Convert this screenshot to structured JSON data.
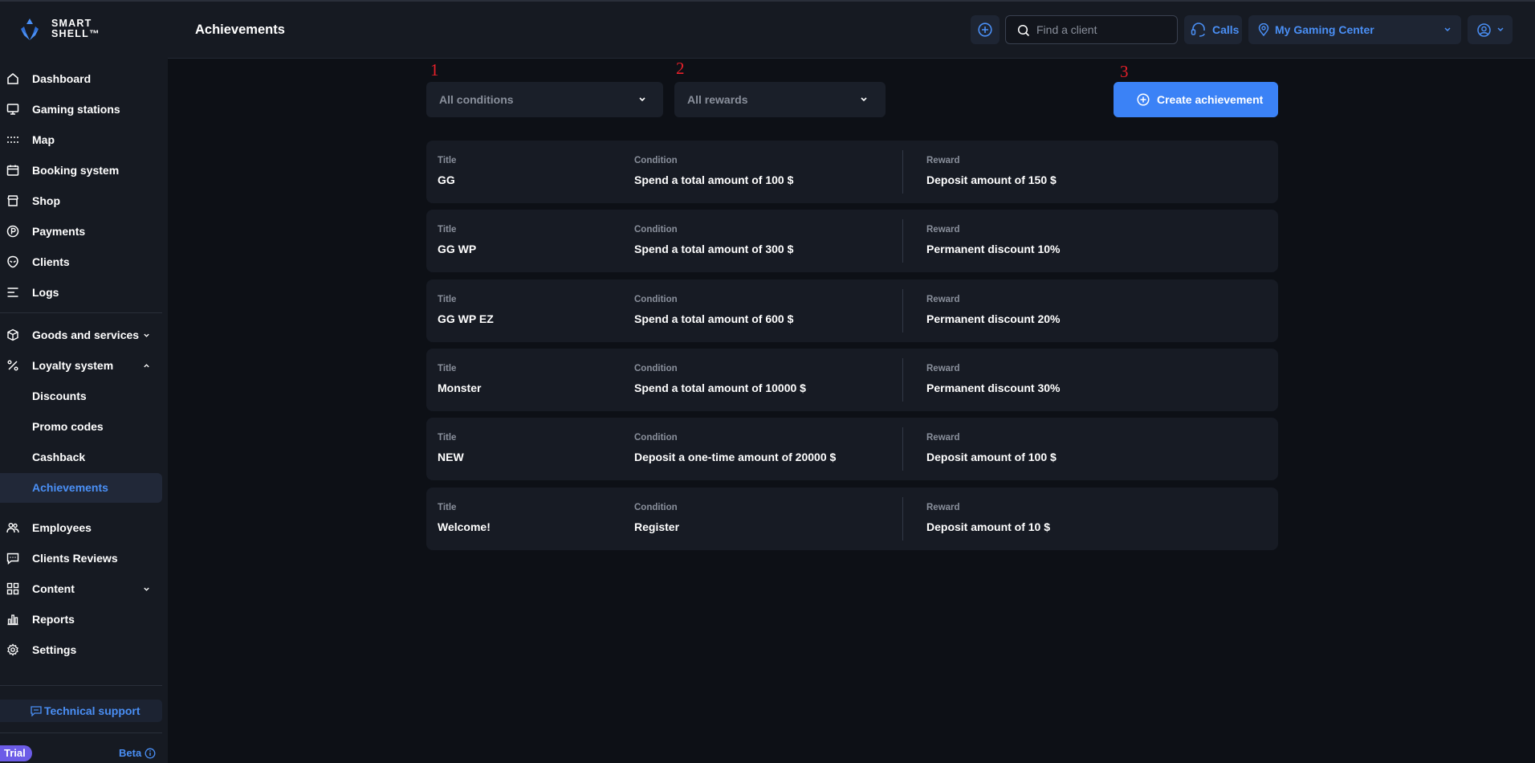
{
  "app": {
    "logo_text_line1": "SMART",
    "logo_text_line2": "SHELL™",
    "accent_color": "#4a8ff5",
    "button_color": "#3b82f6",
    "annotation_color": "#e8202a"
  },
  "header": {
    "title": "Achievements",
    "search_placeholder": "Find a client",
    "calls_label": "Calls",
    "center_name": "My Gaming Center"
  },
  "sidebar": {
    "items": [
      {
        "label": "Dashboard",
        "icon": "home-icon"
      },
      {
        "label": "Gaming stations",
        "icon": "monitor-icon"
      },
      {
        "label": "Map",
        "icon": "grid-dots-icon"
      },
      {
        "label": "Booking system",
        "icon": "calendar-icon"
      },
      {
        "label": "Shop",
        "icon": "store-icon"
      },
      {
        "label": "Payments",
        "icon": "coin-icon"
      },
      {
        "label": "Clients",
        "icon": "alien-icon"
      },
      {
        "label": "Logs",
        "icon": "list-icon"
      },
      {
        "label": "Goods and services",
        "icon": "box-icon"
      },
      {
        "label": "Loyalty system",
        "icon": "percent-icon"
      },
      {
        "label": "Employees",
        "icon": "users-icon"
      },
      {
        "label": "Clients Reviews",
        "icon": "message-icon"
      },
      {
        "label": "Content",
        "icon": "apps-icon"
      },
      {
        "label": "Reports",
        "icon": "chart-icon"
      },
      {
        "label": "Settings",
        "icon": "gear-icon"
      }
    ],
    "loyalty_sub": [
      "Discounts",
      "Promo codes",
      "Cashback",
      "Achievements"
    ],
    "support_label": "Technical support",
    "trial_label": "Trial",
    "beta_label": "Beta"
  },
  "filters": {
    "conditions": "All conditions",
    "rewards": "All rewards",
    "create_label": "Create achievement"
  },
  "annotations": [
    "1",
    "2",
    "3"
  ],
  "columns": {
    "title": "Title",
    "condition": "Condition",
    "reward": "Reward"
  },
  "achievements": [
    {
      "title": "GG",
      "condition": "Spend a total amount of 100 $",
      "reward": "Deposit amount of 150 $"
    },
    {
      "title": "GG WP",
      "condition": "Spend a total amount of 300 $",
      "reward": "Permanent discount 10%"
    },
    {
      "title": "GG WP EZ",
      "condition": "Spend a total amount of 600 $",
      "reward": "Permanent discount 20%"
    },
    {
      "title": "Monster",
      "condition": "Spend a total amount of 10000 $",
      "reward": "Permanent discount 30%"
    },
    {
      "title": "NEW",
      "condition": "Deposit a one-time amount of 20000 $",
      "reward": "Deposit amount of 100 $"
    },
    {
      "title": "Welcome!",
      "condition": "Register",
      "reward": "Deposit amount of 10 $"
    }
  ]
}
